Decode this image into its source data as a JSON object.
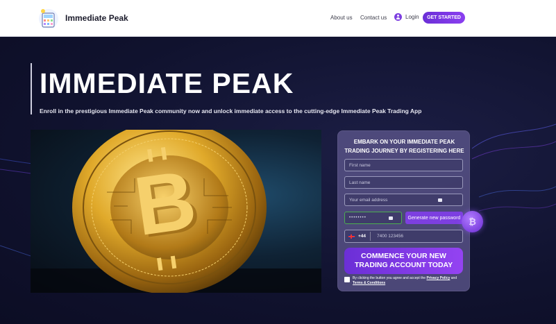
{
  "header": {
    "brand": "Immediate Peak",
    "nav": [
      {
        "label": "About us"
      },
      {
        "label": "Contact us"
      }
    ],
    "login_label": "Login",
    "cta_label": "GET STARTED"
  },
  "hero": {
    "title": "IMMEDIATE PEAK",
    "subtitle": "Enroll in the prestigious Immediate Peak community now and unlock immediate access to the cutting-edge Immediate Peak Trading App"
  },
  "form": {
    "title_line1": "EMBARK ON YOUR IMMEDIATE PEAK",
    "title_line2": "TRADING JOURNEY BY REGISTERING HERE",
    "first_name_placeholder": "First name",
    "last_name_placeholder": "Last name",
    "email_placeholder": "Your email address",
    "password_value": "••••••••",
    "generate_label": "Generate new password",
    "phone_code": "+44",
    "phone_placeholder": "7400 123456",
    "submit_line1": "COMMENCE YOUR NEW",
    "submit_line2": "TRADING ACCOUNT TODAY",
    "terms_prefix": "By clicking the button you agree and accept the",
    "privacy_label": "Privacy Policy",
    "terms_and": "and",
    "terms_label": "Terms & Conditions"
  },
  "colors": {
    "accent": "#7d3fe0",
    "background": "#10122e"
  },
  "icons": [
    "calculator-logo-icon",
    "user-icon",
    "bitcoin-coin-image",
    "bitcoin-orb-icon",
    "uk-flag-icon",
    "field-icon"
  ]
}
